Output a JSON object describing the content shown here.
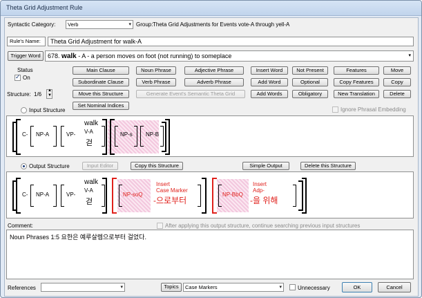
{
  "window": {
    "title": "Theta Grid Adjustment Rule"
  },
  "top": {
    "category_label": "Syntactic Category:",
    "category_value": "Verb",
    "group_label": "Group:",
    "group_value": "Theta Grid Adjustments for Events vote-A through yell-A",
    "rule_name_label": "Rule's Name:",
    "rule_name_value": "Theta Grid Adjustment for walk-A"
  },
  "trigger": {
    "button": "Trigger Word",
    "number": "678.",
    "word": "walk",
    "rest": "- A - a person moves on foot (not running) to someplace"
  },
  "status": {
    "label": "Status",
    "checkbox_label": "On",
    "on": true
  },
  "structure": {
    "label": "Structure:",
    "value": "1/6"
  },
  "buttons": {
    "main_clause": "Main Clause",
    "subordinate_clause": "Subordinate Clause",
    "move_structure": "Move this Structure",
    "set_nominal": "Set Nominal Indices",
    "noun_phrase": "Noun Phrase",
    "verb_phrase": "Verb Phrase",
    "generate": "Generate Event's Semantic Theta Grid",
    "adjective_phrase": "Adjective Phrase",
    "adverb_phrase": "Adverb Phrase",
    "insert_word": "Insert Word",
    "add_word": "Add Word",
    "add_words": "Add Words",
    "not_present": "Not Present",
    "optional": "Optional",
    "obligatory": "Obligatory",
    "features": "Features",
    "copy_features": "Copy Features",
    "new_translation": "New Translation",
    "move": "Move",
    "copy": "Copy",
    "delete": "Delete"
  },
  "input": {
    "radio_label": "Input Structure",
    "ignore_label": "Ignore Phrasal Embedding",
    "c": "C-",
    "np_a": "NP-A",
    "vp": "VP-",
    "verb_word": "walk",
    "verb_sense": "V-A",
    "verb_korean": "걷",
    "np_s": "NP-s",
    "np_b": "NP-B"
  },
  "output": {
    "radio_label": "Output Structure",
    "input_editor": "Input Editor",
    "copy_structure": "Copy this Structure",
    "simple_output": "Simple Output",
    "delete_structure": "Delete this Structure",
    "c": "C-",
    "np_a": "NP-A",
    "vp": "VP-",
    "verb_word": "walk",
    "verb_sense": "V-A",
    "verb_korean": "걷",
    "np_soq": "NP-soQ",
    "insert1_label": "Insert",
    "insert1_name": "Case Marker",
    "insert1_korean": "-으로부터",
    "np_bbq": "NP-BbQ",
    "insert2_label": "Insert",
    "insert2_name": "Adp-",
    "insert2_korean": "-을 위해"
  },
  "comment": {
    "label": "Comment:",
    "after_label": "After applying this output structure, continue searching previous input structures",
    "text": "Noun Phrases 1:5  요한은 예루살렘으로부터 걸었다."
  },
  "bottom": {
    "references_label": "References",
    "references_value": "",
    "topics_button": "Topics",
    "topics_value": "Case Markers",
    "unnecessary_label": "Unnecessary",
    "ok": "OK",
    "cancel": "Cancel"
  },
  "colors": {
    "accent_red": "#e0201b",
    "hatch_pink": "#f3c7de"
  }
}
